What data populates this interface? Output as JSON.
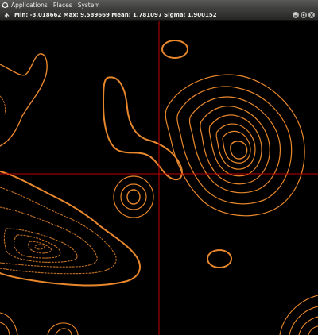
{
  "panel": {
    "logo_icon": "ubuntu-logo-icon",
    "menus": [
      "Applications",
      "Places",
      "System"
    ]
  },
  "window": {
    "menu_icon": "window-menu-icon",
    "title": "Min: -3.018662 Max: 9.589669 Mean: 1.781097 Sigma: 1.900152",
    "controls": [
      "minimize-icon",
      "maximize-icon",
      "close-icon"
    ]
  },
  "plot": {
    "contour_color": "#e8872c",
    "crosshair_color": "#c00000",
    "background": "#000000"
  }
}
